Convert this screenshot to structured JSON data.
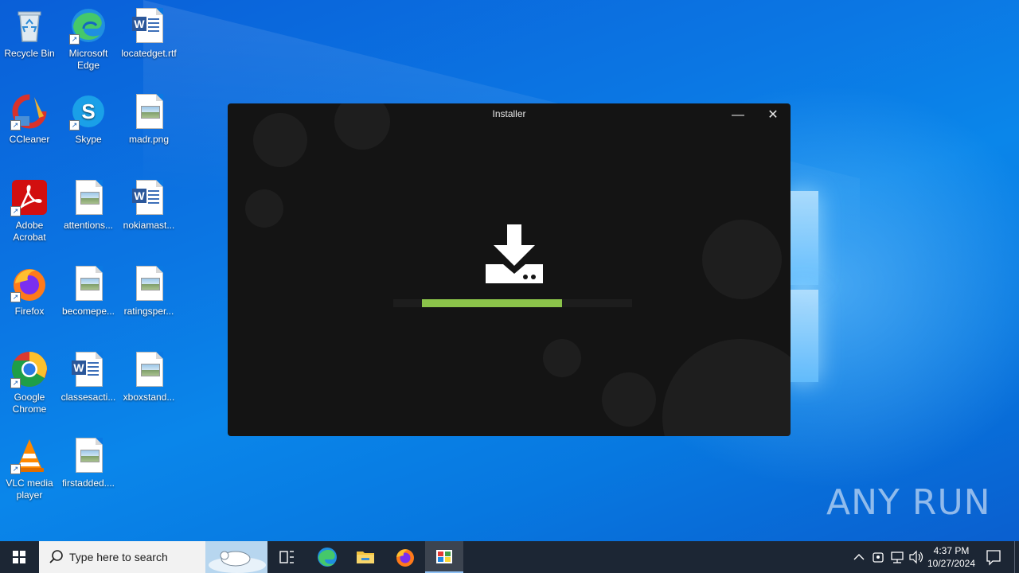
{
  "desktop": {
    "icons": [
      {
        "label": "Recycle Bin",
        "icon": "recycle-bin-icon"
      },
      {
        "label": "Microsoft Edge",
        "icon": "edge-icon"
      },
      {
        "label": "locatedget.rtf",
        "icon": "word-document-icon"
      },
      {
        "label": "CCleaner",
        "icon": "ccleaner-icon"
      },
      {
        "label": "Skype",
        "icon": "skype-icon"
      },
      {
        "label": "madr.png",
        "icon": "image-file-icon"
      },
      {
        "label": "Adobe Acrobat",
        "icon": "acrobat-icon"
      },
      {
        "label": "attentions...",
        "icon": "image-file-icon"
      },
      {
        "label": "nokiamast...",
        "icon": "word-document-icon"
      },
      {
        "label": "Firefox",
        "icon": "firefox-icon"
      },
      {
        "label": "becomepe...",
        "icon": "image-file-icon"
      },
      {
        "label": "ratingsper...",
        "icon": "image-file-icon"
      },
      {
        "label": "Google Chrome",
        "icon": "chrome-icon"
      },
      {
        "label": "classesacti...",
        "icon": "word-document-icon"
      },
      {
        "label": "xboxstand...",
        "icon": "image-file-icon"
      },
      {
        "label": "VLC media player",
        "icon": "vlc-icon"
      },
      {
        "label": "firstadded....",
        "icon": "image-file-icon"
      }
    ],
    "watermark": "ANY RUN"
  },
  "installer": {
    "title": "Installer",
    "minimize_glyph": "—",
    "close_glyph": "✕",
    "progress_percent": 77,
    "progress_color": "#8bc34a"
  },
  "taskbar": {
    "search_placeholder": "Type here to search",
    "pinned": [
      "task-view-icon",
      "edge-icon",
      "file-explorer-icon",
      "firefox-icon",
      "installer-app-icon"
    ],
    "time": "4:37 PM",
    "date": "10/27/2024"
  }
}
